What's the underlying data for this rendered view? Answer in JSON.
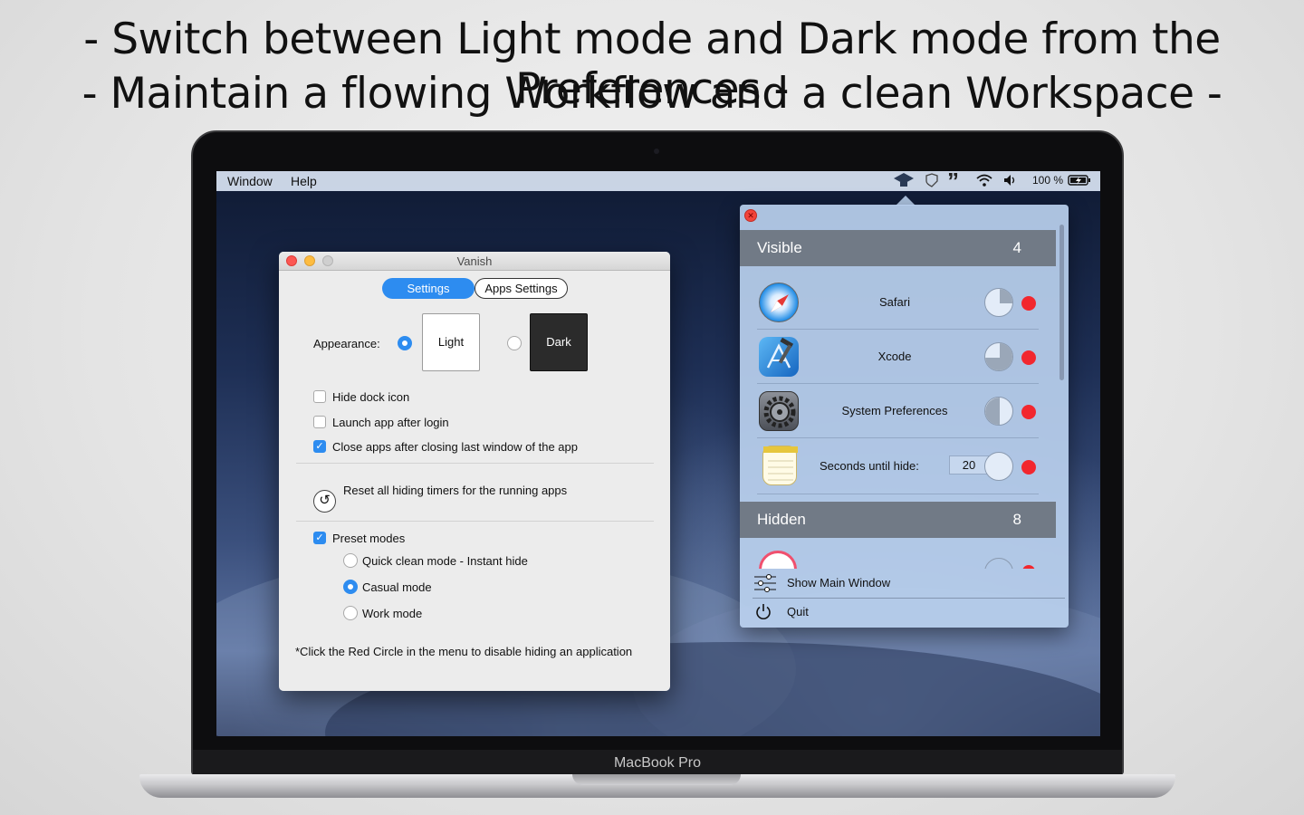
{
  "headline": {
    "line1": "- Switch between Light mode and Dark mode from the Preferences -",
    "line2": "- Maintain a flowing Workflow and a clean Workspace -"
  },
  "device": {
    "label": "MacBook Pro"
  },
  "menubar": {
    "menus": [
      "Window",
      "Help"
    ],
    "battery_text": "100 %",
    "status_icons": [
      "vanish-icon",
      "security-icon",
      "quote-icon",
      "wifi-icon",
      "volume-icon",
      "battery-icon"
    ]
  },
  "prefs_window": {
    "title": "Vanish",
    "tabs": {
      "settings": "Settings",
      "apps_settings": "Apps Settings"
    },
    "appearance_label": "Appearance:",
    "appearance_options": {
      "light": "Light",
      "dark": "Dark",
      "selected": "Light"
    },
    "checkboxes": [
      {
        "label": "Hide dock icon",
        "checked": false
      },
      {
        "label": "Launch app after login",
        "checked": false
      },
      {
        "label": "Close apps after closing last window of the app",
        "checked": true
      }
    ],
    "reset_label": "Reset all hiding timers for the running apps",
    "preset_modes": {
      "label": "Preset modes",
      "checked": true,
      "options": [
        "Quick clean mode - Instant hide",
        "Casual mode",
        "Work mode"
      ],
      "selected": "Casual mode"
    },
    "footnote": "*Click the Red Circle in the menu to disable hiding an application"
  },
  "menu_panel": {
    "visible_label": "Visible",
    "visible_count": "4",
    "apps": [
      {
        "name": "Safari",
        "timer_fraction": 0.25
      },
      {
        "name": "Xcode",
        "timer_fraction": 0.75
      },
      {
        "name": "System Preferences",
        "timer_fraction": 0.5
      }
    ],
    "seconds_label": "Seconds until hide:",
    "seconds_value": "20",
    "hidden_label": "Hidden",
    "hidden_count": "8",
    "show_main_window": "Show Main Window",
    "quit": "Quit"
  },
  "colors": {
    "accent": "#2d8cf0",
    "disable_dot": "#f2272e",
    "section_header": "#717a86"
  }
}
